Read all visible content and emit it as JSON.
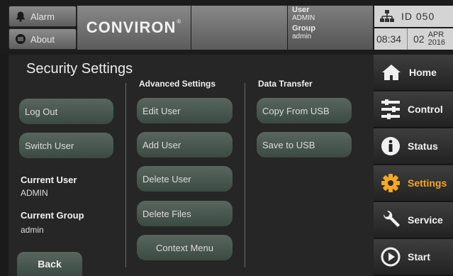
{
  "header": {
    "alarm_label": "Alarm",
    "about_label": "About",
    "logo_text": "CONVIRON",
    "logo_mark": "®",
    "user_label": "User",
    "user_value": "ADMIN",
    "group_label": "Group",
    "group_value": "admin",
    "id_text": "ID  050",
    "time": "08:34",
    "date_day": "02",
    "date_month": "APR",
    "date_year": "2016"
  },
  "page": {
    "title": "Security Settings",
    "col_advanced": "Advanced Settings",
    "col_transfer": "Data Transfer"
  },
  "buttons": {
    "log_out": "Log Out",
    "switch_user": "Switch User",
    "edit_user": "Edit User",
    "add_user": "Add User",
    "delete_user": "Delete User",
    "delete_files": "Delete Files",
    "context_menu": "Context Menu",
    "copy_from_usb": "Copy From USB",
    "save_to_usb": "Save to USB",
    "back": "Back"
  },
  "info": {
    "current_user_label": "Current User",
    "current_user_value": "ADMIN",
    "current_group_label": "Current Group",
    "current_group_value": "admin"
  },
  "nav": {
    "home": "Home",
    "control": "Control",
    "status": "Status",
    "settings": "Settings",
    "service": "Service",
    "start": "Start",
    "active_color": "#f5a623"
  }
}
